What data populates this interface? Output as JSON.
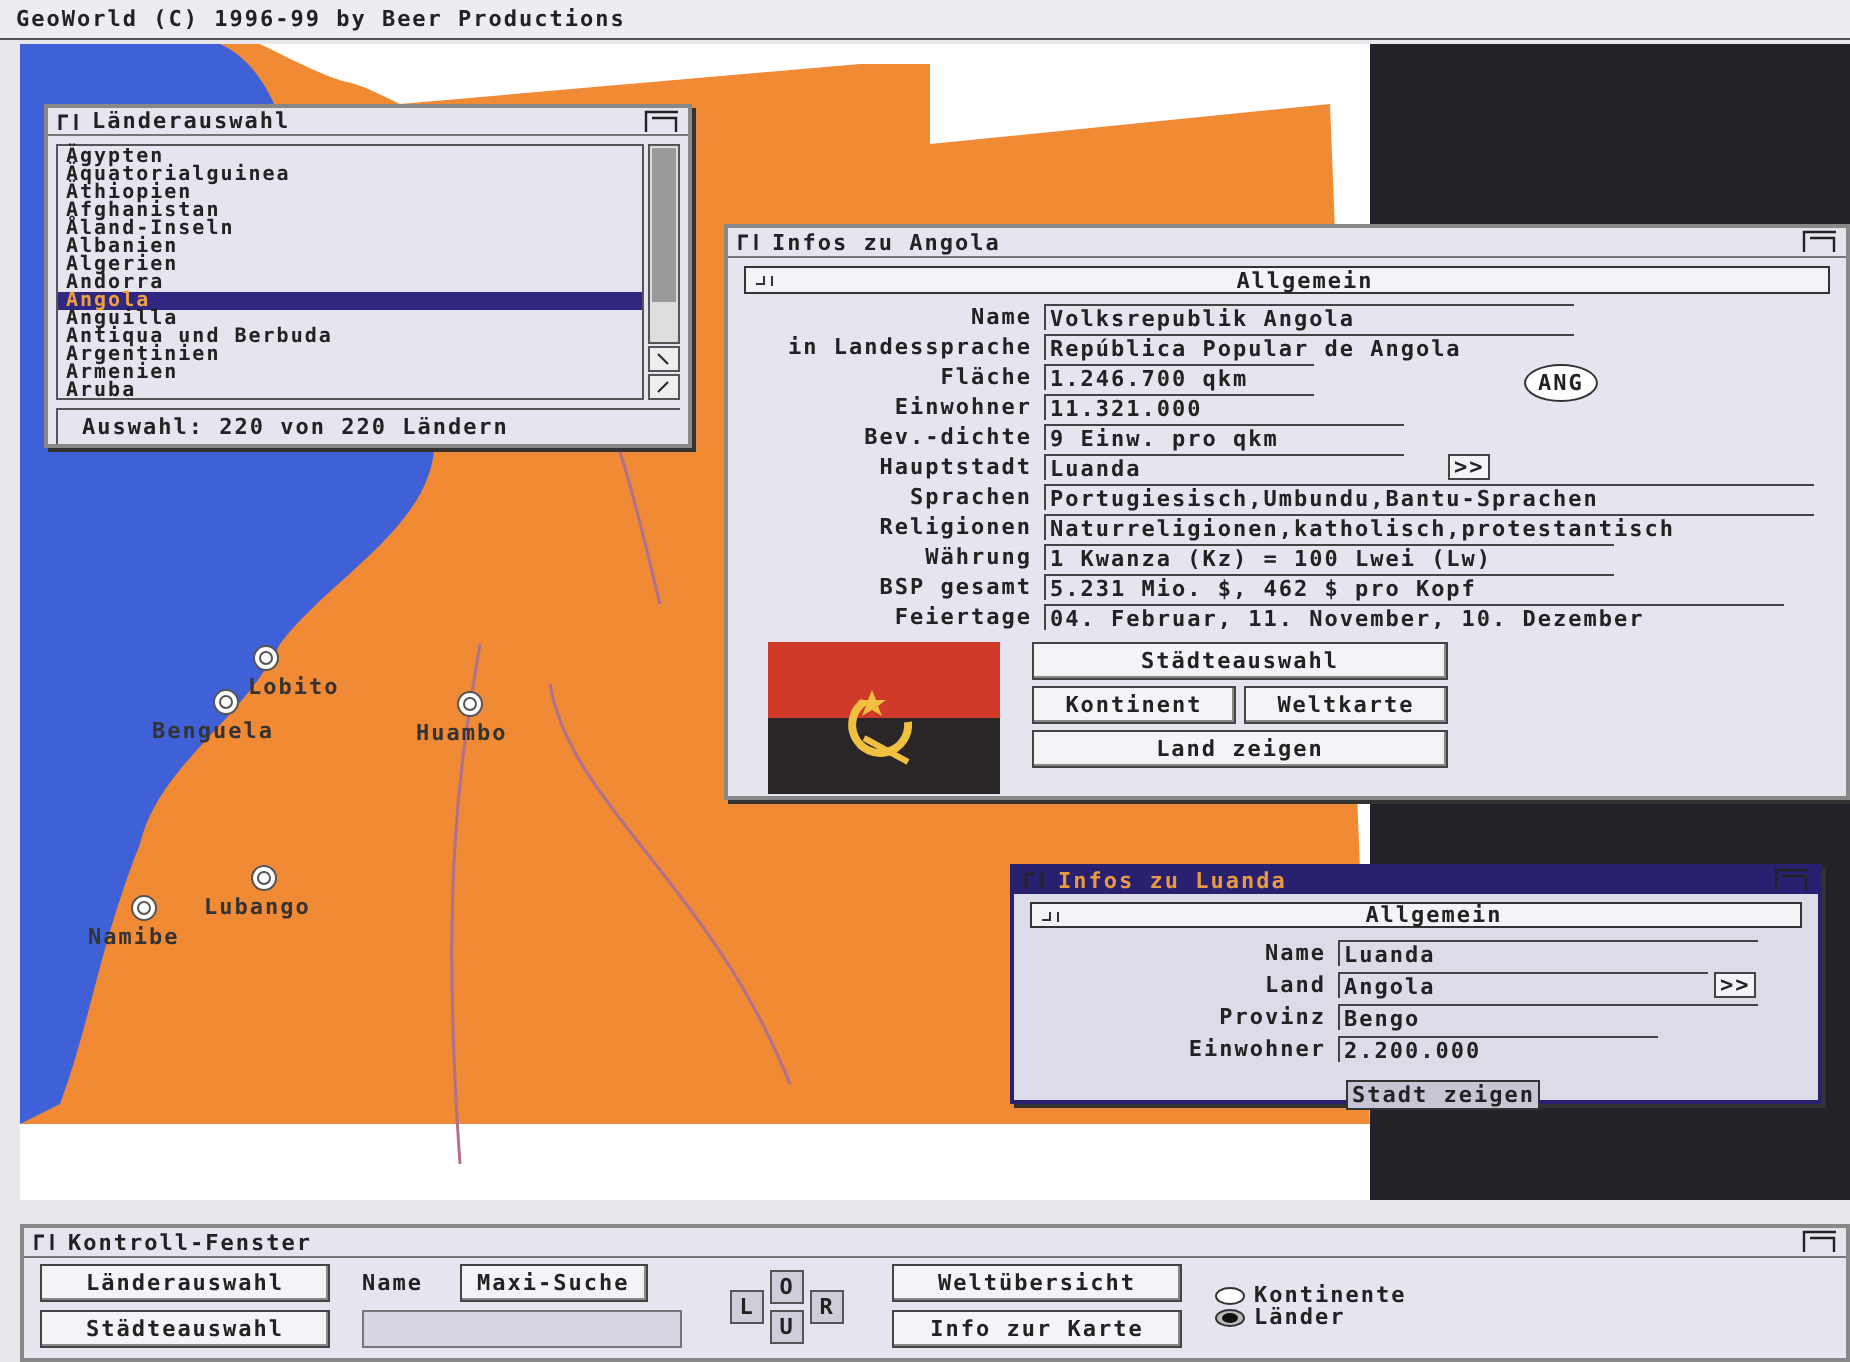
{
  "screen": {
    "title": "GeoWorld (C) 1996-99 by Beer Productions"
  },
  "map": {
    "cities": [
      {
        "name": "Lobito"
      },
      {
        "name": "Benguela"
      },
      {
        "name": "Huambo"
      },
      {
        "name": "Lubango"
      },
      {
        "name": "Namibe"
      }
    ]
  },
  "country_list": {
    "title": "Länderauswahl",
    "active": false,
    "items": [
      {
        "label": "Ägypten",
        "selected": false
      },
      {
        "label": "Äquatorialguinea",
        "selected": false
      },
      {
        "label": "Äthiopien",
        "selected": false
      },
      {
        "label": "Afghanistan",
        "selected": false
      },
      {
        "label": "Åland-Inseln",
        "selected": false
      },
      {
        "label": "Albanien",
        "selected": false
      },
      {
        "label": "Algerien",
        "selected": false
      },
      {
        "label": "Andorra",
        "selected": false
      },
      {
        "label": "Angola",
        "selected": true
      },
      {
        "label": "Anguilla",
        "selected": false
      },
      {
        "label": "Antiqua und Berbuda",
        "selected": false
      },
      {
        "label": "Argentinien",
        "selected": false
      },
      {
        "label": "Armenien",
        "selected": false
      },
      {
        "label": "Aruba",
        "selected": false
      }
    ],
    "status": "Auswahl: 220 von 220 Ländern"
  },
  "country_info": {
    "title": "Infos zu Angola",
    "active": false,
    "tab": "Allgemein",
    "fields": [
      {
        "label": "Name",
        "value": "Volksrepublik Angola"
      },
      {
        "label": "in Landessprache",
        "value": "República Popular de Angola"
      },
      {
        "label": "Fläche",
        "value": "1.246.700 qkm"
      },
      {
        "label": "Einwohner",
        "value": "11.321.000"
      },
      {
        "label": "Bev.-dichte",
        "value": "9 Einw. pro qkm"
      },
      {
        "label": "Hauptstadt",
        "value": "Luanda"
      },
      {
        "label": "Sprachen",
        "value": "Portugiesisch,Umbundu,Bantu-Sprachen"
      },
      {
        "label": "Religionen",
        "value": "Naturreligionen,katholisch,protestantisch"
      },
      {
        "label": "Währung",
        "value": "1 Kwanza (Kz) = 100 Lwei  (Lw)"
      },
      {
        "label": "BSP gesamt",
        "value": "5.231 Mio. $, 462 $ pro Kopf"
      },
      {
        "label": "Feiertage",
        "value": "04. Februar, 11. November, 10. Dezember"
      }
    ],
    "code": "ANG",
    "capital_button": ">>",
    "buttons": [
      "Städteauswahl",
      "Kontinent",
      "Weltkarte",
      "Land zeigen"
    ]
  },
  "city_info": {
    "title": "Infos zu Luanda",
    "active": true,
    "tab": "Allgemein",
    "fields": [
      {
        "label": "Name",
        "value": "Luanda"
      },
      {
        "label": "Land",
        "value": "Angola"
      },
      {
        "label": "Provinz",
        "value": "Bengo"
      },
      {
        "label": "Einwohner",
        "value": "2.200.000"
      }
    ],
    "country_button": ">>",
    "button": "Stadt zeigen"
  },
  "control": {
    "title": "Kontroll-Fenster",
    "buttons": [
      "Länderauswahl",
      "Städteauswahl"
    ],
    "name_label": "Name",
    "search_button": "Maxi-Suche",
    "directions": [
      "L",
      "O",
      "U",
      "R"
    ],
    "map_buttons": [
      "Weltübersicht",
      "Info zur Karte"
    ],
    "options": [
      {
        "label": "Kontinente",
        "selected": false
      },
      {
        "label": "Länder",
        "selected": true
      }
    ]
  }
}
